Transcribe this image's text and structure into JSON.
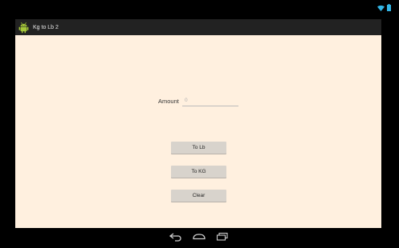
{
  "app": {
    "title": "Kg to Lb 2"
  },
  "form": {
    "amount_label": "Amount",
    "amount_placeholder": "0"
  },
  "buttons": {
    "to_lb": "To Lb",
    "to_kg": "To KG",
    "clear": "Clear"
  },
  "icons": {
    "status": [
      "wifi-icon",
      "battery-icon"
    ],
    "app": "android-icon",
    "navigation": [
      "back-icon",
      "home-icon",
      "recents-icon"
    ]
  },
  "colors": {
    "background": "#fff0df",
    "action_bar": "#222222",
    "button": "#d8d3cc",
    "system_bar": "#000000",
    "accent": "#33b5e5",
    "android_green": "#a4c639"
  }
}
